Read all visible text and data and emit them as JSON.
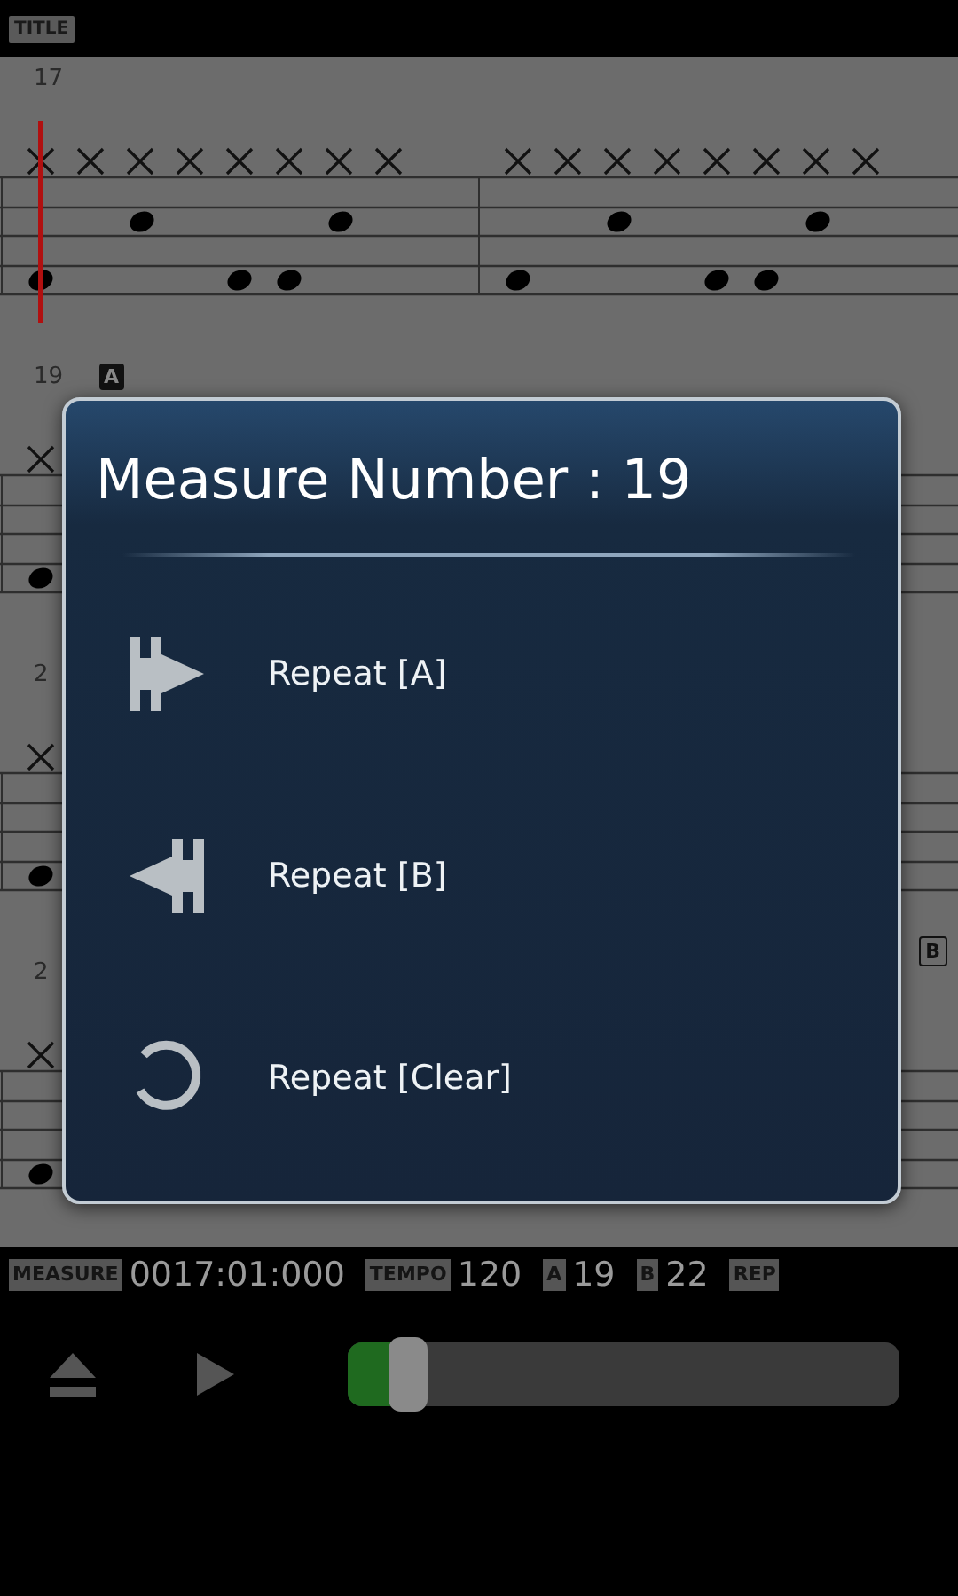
{
  "header": {
    "title_badge": "TITLE"
  },
  "score": {
    "rows": [
      {
        "number": "17",
        "playhead": true
      },
      {
        "number": "19",
        "playhead": false,
        "marker": {
          "label": "A",
          "kind": "start"
        }
      },
      {
        "number": "2",
        "playhead": false,
        "marker": {
          "label": "B",
          "kind": "end"
        }
      },
      {
        "number": "2",
        "playhead": false
      }
    ]
  },
  "dialog": {
    "title": "Measure Number : 19",
    "items": [
      {
        "kind": "repeat-a",
        "label": "Repeat [A]"
      },
      {
        "kind": "repeat-b",
        "label": "Repeat [B]"
      },
      {
        "kind": "clear",
        "label": "Repeat [Clear]"
      }
    ]
  },
  "status_bar": [
    {
      "kind": "badge",
      "text": "MEASURE"
    },
    {
      "kind": "value",
      "text": "0017:01:000"
    },
    {
      "kind": "badge",
      "text": "TEMPO"
    },
    {
      "kind": "value",
      "text": "120"
    },
    {
      "kind": "badge",
      "text": "A"
    },
    {
      "kind": "value",
      "text": "19"
    },
    {
      "kind": "badge",
      "text": "B"
    },
    {
      "kind": "value",
      "text": "22"
    },
    {
      "kind": "badge",
      "text": "REP"
    }
  ],
  "transport": {
    "position": {
      "level": 0.11
    }
  }
}
